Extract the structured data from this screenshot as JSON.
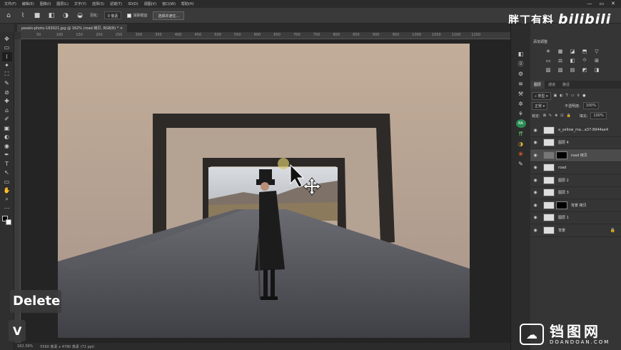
{
  "menu": [
    "文件(F)",
    "编辑(E)",
    "图像(I)",
    "图层(L)",
    "文字(Y)",
    "选择(S)",
    "滤镜(T)",
    "3D(D)",
    "视图(V)",
    "窗口(W)",
    "帮助(H)"
  ],
  "window_controls": [
    "—",
    "▭",
    "✕"
  ],
  "options": {
    "feather_label": "羽化:",
    "feather_value": "0 像素",
    "antialias_label": "消除锯齿",
    "select_mask_button": "选择并遮住..."
  },
  "watermark_top": {
    "name": "胖丁有料",
    "site": "bilibili"
  },
  "tab": {
    "label": "pexels-photo-163021.jpg @ 162% (road 拷贝, RGB/8) *",
    "close": "×"
  },
  "ruler_ticks": [
    "50",
    "100",
    "150",
    "200",
    "250",
    "300",
    "350",
    "400",
    "450",
    "500",
    "550",
    "600",
    "650",
    "700",
    "750",
    "800",
    "850",
    "900",
    "950",
    "1000",
    "1050",
    "1100",
    "1150"
  ],
  "tools": [
    "✥",
    "▭",
    "⌇",
    "✦",
    "⛶",
    "✎",
    "⊘",
    "✚",
    "⌂",
    "✐",
    "▣",
    "◐",
    "◉",
    "✒",
    "T",
    "↖",
    "▭",
    "✋",
    "⌕",
    "⋯"
  ],
  "status": {
    "zoom": "162.39%",
    "doc": "5560 像素 x 4780 像素 (72 ppi)"
  },
  "keys": {
    "delete": "Delete",
    "v": "V"
  },
  "right_dock": [
    "◧",
    "⓪",
    "⚙",
    "≋",
    "⚒",
    "✲",
    "⚘",
    "RA",
    "ff",
    "◑",
    "❀",
    "✎"
  ],
  "adjustments": {
    "title": "添加调整",
    "icons": [
      "☀",
      "▦",
      "◪",
      "⬒",
      "▽",
      "▭",
      "⚖",
      "◧",
      "⟐",
      "⊞",
      "▨",
      "▧",
      "▤",
      "◩",
      "◨"
    ]
  },
  "panel_tabs": [
    "图层",
    "通道",
    "路径"
  ],
  "layers_controls": {
    "filter": "类型",
    "blend": "正常",
    "opacity_label": "不透明度:",
    "opacity": "100%",
    "lock_label": "锁定:",
    "fill_label": "填充:",
    "fill": "100%"
  },
  "layers": [
    {
      "name": "a_yellow_ma...a37-8944ae4",
      "thumb": "light",
      "mask": false,
      "selected": false,
      "lock": ""
    },
    {
      "name": "图层 4",
      "thumb": "light",
      "mask": false,
      "selected": false,
      "lock": ""
    },
    {
      "name": "road 拷贝",
      "thumb": "dark",
      "mask": true,
      "selected": true,
      "lock": ""
    },
    {
      "name": "road",
      "thumb": "light",
      "mask": false,
      "selected": false,
      "lock": ""
    },
    {
      "name": "图层 2",
      "thumb": "light",
      "mask": false,
      "selected": false,
      "lock": ""
    },
    {
      "name": "图层 3",
      "thumb": "light",
      "mask": false,
      "selected": false,
      "lock": ""
    },
    {
      "name": "背景 拷贝",
      "thumb": "light",
      "mask": true,
      "selected": false,
      "lock": ""
    },
    {
      "name": "图层 1",
      "thumb": "light",
      "mask": false,
      "selected": false,
      "lock": ""
    },
    {
      "name": "背景",
      "thumb": "light",
      "mask": false,
      "selected": false,
      "lock": "🔒"
    }
  ],
  "watermark_bottom": {
    "name": "铛图网",
    "site": "DOANDOAN.COM"
  }
}
